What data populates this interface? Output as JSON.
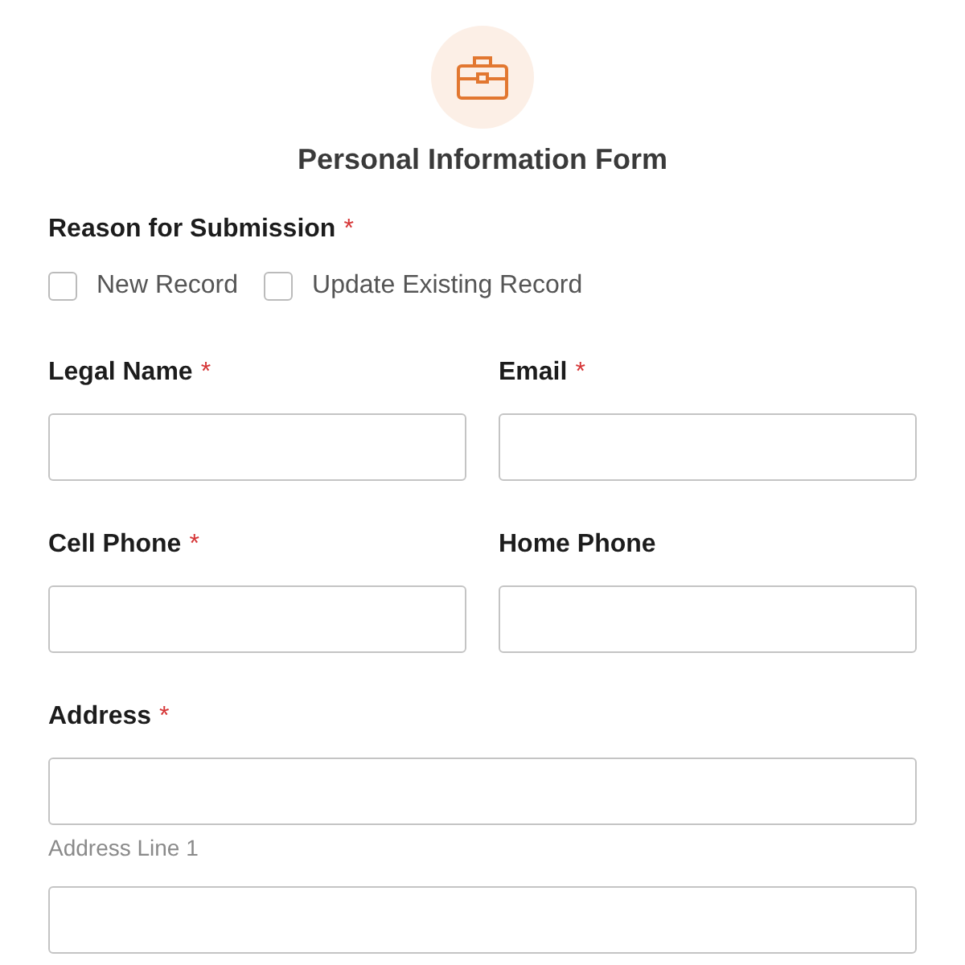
{
  "header": {
    "title": "Personal Information Form"
  },
  "reason": {
    "label": "Reason for Submission",
    "required_mark": "*",
    "options": [
      {
        "label": "New Record",
        "checked": false
      },
      {
        "label": "Update Existing Record",
        "checked": false
      }
    ]
  },
  "fields": [
    {
      "label": "Legal Name",
      "required_mark": "*"
    },
    {
      "label": "Email",
      "required_mark": "*"
    },
    {
      "label": "Cell Phone",
      "required_mark": "*"
    },
    {
      "label": "Home Phone"
    }
  ],
  "address": {
    "label": "Address",
    "required_mark": "*",
    "line_1_hint": "Address Line 1"
  }
}
